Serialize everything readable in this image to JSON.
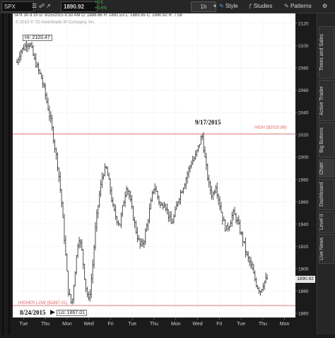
{
  "toolbar": {
    "symbol": "SPX",
    "period": "SPX 30 d 1h",
    "price": "1890.92",
    "change": "+0.5",
    "change_pct": "+0.4%",
    "ohlc": "D: 9/25/2015 8:30 AM  O: 1888.86  H: 1891.53  L: 1883.95  C: 1890.92  R: 7.58",
    "timeframe": "1h",
    "style_label": "Style",
    "studies_label": "Studies",
    "patterns_label": "Patterns"
  },
  "chart": {
    "watermark": "© 2015 © TD Ameritrade IP Company, Inc.",
    "hi_label": "Hi: 2103.47",
    "lo_label": "Lo: 1867.01",
    "high_line_label": "HIGH ($2020.86)",
    "low_line_label": "HIGHER LOW ($1867.01)",
    "annot_high_date": "9/17/2015",
    "annot_low_date": "8/24/2015",
    "current_price": "1890.92"
  },
  "sidebar": {
    "tabs": [
      "Times and Sales",
      "Active Trader",
      "Big Buttons",
      "Chart",
      "Dashboard",
      "Level II",
      "Live News"
    ]
  },
  "chart_data": {
    "type": "candlestick",
    "y_ticks": [
      1860,
      1880,
      1900,
      1920,
      1940,
      1960,
      1980,
      2000,
      2020,
      2040,
      2060,
      2080,
      2100,
      2120
    ],
    "x_ticks": [
      "Tue",
      "Thu",
      "Mon",
      "Wed",
      "Fri",
      "Tue",
      "Thu",
      "Mon",
      "Wed",
      "Fri",
      "Tue",
      "Thu",
      "Mon"
    ],
    "ylim": [
      1855,
      2125
    ],
    "close_path": [
      2085,
      2095,
      2098,
      2103,
      2100,
      2088,
      2080,
      2072,
      2060,
      2045,
      2030,
      2010,
      1990,
      1960,
      1920,
      1880,
      1867,
      1900,
      1930,
      1915,
      1885,
      1870,
      1900,
      1940,
      1965,
      1985,
      1990,
      1975,
      1955,
      1945,
      1940,
      1958,
      1975,
      1962,
      1945,
      1930,
      1920,
      1925,
      1940,
      1958,
      1975,
      1965,
      1955,
      1960,
      1950,
      1940,
      1948,
      1962,
      1970,
      1978,
      1988,
      1996,
      2000,
      2010,
      2020,
      1995,
      1975,
      1965,
      1975,
      1960,
      1945,
      1935,
      1940,
      1950,
      1945,
      1935,
      1925,
      1912,
      1905,
      1895,
      1885,
      1880,
      1888,
      1890.92
    ],
    "high_level": 2020.86,
    "low_level": 1867.01
  }
}
